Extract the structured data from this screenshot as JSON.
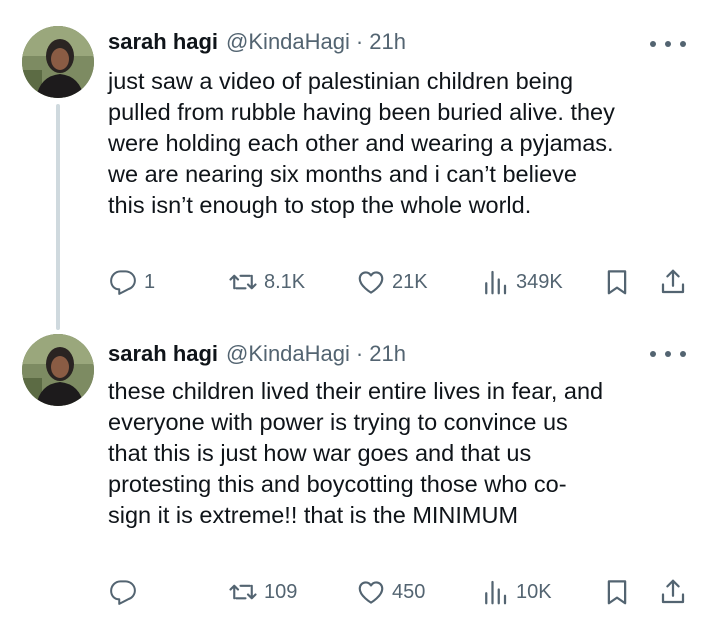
{
  "tweets": [
    {
      "author_name": "sarah hagi",
      "handle": "@KindaHagi",
      "separator": "·",
      "time": "21h",
      "text": "just saw a video of palestinian children being\npulled from rubble having been buried alive. they\nwere holding each other and wearing a pyjamas.\nwe are nearing six months and i can’t believe\nthis isn’t enough to stop the whole world.",
      "replies": "1",
      "reposts": "8.1K",
      "likes": "21K",
      "views": "349K"
    },
    {
      "author_name": "sarah hagi",
      "handle": "@KindaHagi",
      "separator": "·",
      "time": "21h",
      "text": "these children lived their entire lives in fear, and\neveryone with power is trying to convince us\nthat this is just how war goes and that us\nprotesting this and boycotting those who co-\nsign it is extreme!! that is the MINIMUM",
      "replies": "",
      "reposts": "109",
      "likes": "450",
      "views": "10K"
    }
  ],
  "icons": {
    "reply": "reply-icon",
    "repost": "retweet-icon",
    "like": "heart-icon",
    "views": "analytics-icon",
    "bookmark": "bookmark-icon",
    "share": "share-icon",
    "more": "more-icon"
  },
  "colors": {
    "text": "#0f1419",
    "secondary": "#536471",
    "thread_line": "#cfd9de",
    "background": "#ffffff"
  }
}
